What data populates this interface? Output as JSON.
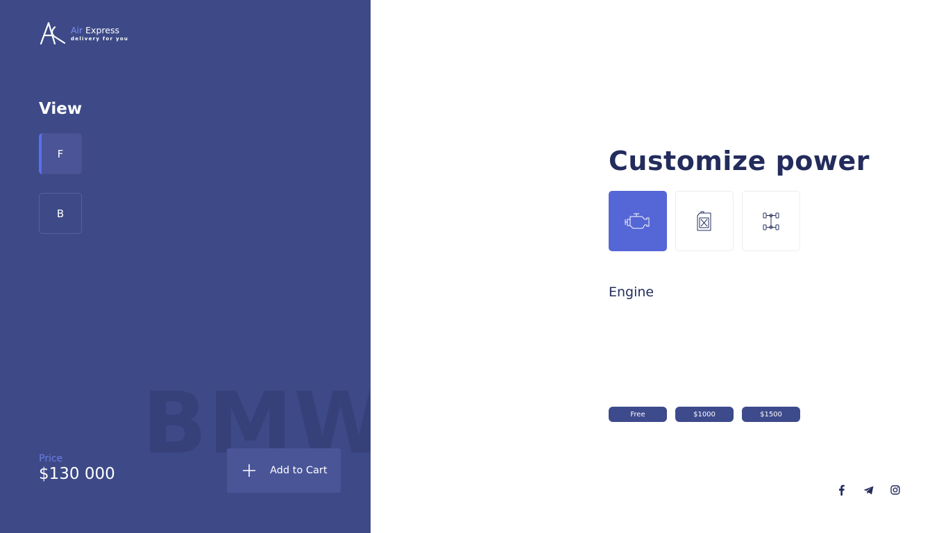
{
  "brand": {
    "name_accent": "Air",
    "name_rest": "Express",
    "tagline": "delivery for you"
  },
  "view": {
    "title": "View",
    "options": [
      {
        "label": "F",
        "active": true
      },
      {
        "label": "B",
        "active": false
      }
    ]
  },
  "watermark": "BMW",
  "price": {
    "label": "Price",
    "value": "$130 000"
  },
  "cart": {
    "label": "Add to Cart",
    "icon": "plus-icon"
  },
  "customize": {
    "title": "Customize power",
    "options": [
      {
        "icon": "engine-icon",
        "selected": true
      },
      {
        "icon": "fuel-canister-icon",
        "selected": false
      },
      {
        "icon": "chassis-icon",
        "selected": false
      }
    ],
    "section_label": "Engine",
    "prices": [
      "Free",
      "$1000",
      "$1500"
    ]
  },
  "social": [
    "facebook-icon",
    "telegram-icon",
    "instagram-icon"
  ],
  "colors": {
    "sidebar": "#3d4a87",
    "accent": "#5566d6",
    "heading": "#232c5c",
    "pill": "#3d4a8c"
  }
}
